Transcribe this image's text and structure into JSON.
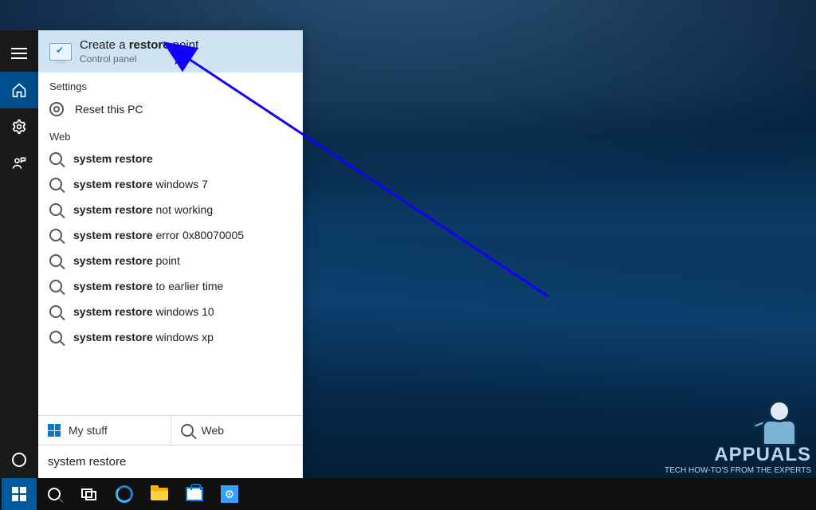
{
  "best_match": {
    "title_pre": "Create a ",
    "title_bold": "restore",
    "title_post": " point",
    "subtitle": "Control panel"
  },
  "sections": {
    "settings": "Settings",
    "web": "Web"
  },
  "settings_items": [
    {
      "label": "Reset this PC"
    }
  ],
  "web_items": [
    {
      "bold": "system restore",
      "rest": ""
    },
    {
      "bold": "system restore",
      "rest": " windows 7"
    },
    {
      "bold": "system restore",
      "rest": " not working"
    },
    {
      "bold": "system restore",
      "rest": " error 0x80070005"
    },
    {
      "bold": "system restore",
      "rest": " point"
    },
    {
      "bold": "system restore",
      "rest": " to earlier time"
    },
    {
      "bold": "system restore",
      "rest": " windows 10"
    },
    {
      "bold": "system restore",
      "rest": " windows xp"
    }
  ],
  "scope": {
    "my_stuff": "My stuff",
    "web": "Web"
  },
  "search_query": "system restore",
  "watermark": {
    "brand": "APPUALS",
    "tagline": "TECH HOW-TO'S FROM THE EXPERTS"
  }
}
